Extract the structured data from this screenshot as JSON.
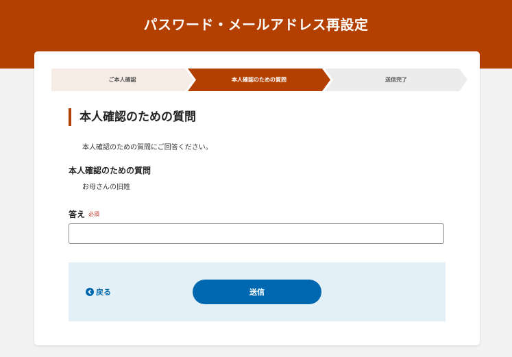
{
  "header": {
    "title": "パスワード・メールアドレス再設定"
  },
  "steps": [
    {
      "label": "ご本人確認",
      "state": "done"
    },
    {
      "label": "本人確認のための質問",
      "state": "active"
    },
    {
      "label": "送信完了",
      "state": "pending"
    }
  ],
  "section": {
    "title": "本人確認のための質問",
    "intro": "本人確認のための質問にご回答ください。"
  },
  "question": {
    "label": "本人確認のための質問",
    "value": "お母さんの旧姓"
  },
  "answer": {
    "label": "答え",
    "required": "必須",
    "value": "",
    "placeholder": ""
  },
  "actions": {
    "back_label": "戻る",
    "submit_label": "送信"
  },
  "colors": {
    "brand": "#b34000",
    "accent": "#0068b0",
    "action_bg": "#e4f0f7"
  }
}
